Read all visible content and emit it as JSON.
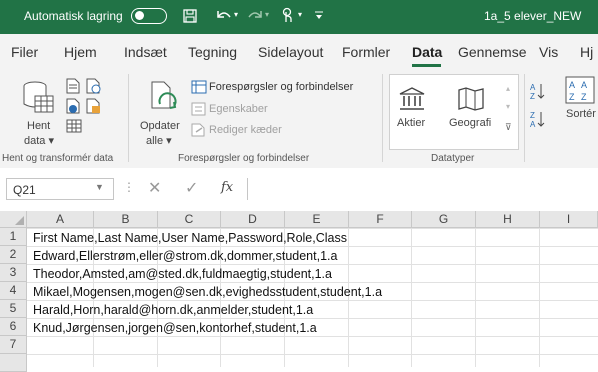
{
  "titlebar": {
    "autosave_label": "Automatisk lagring",
    "filename": "1a_5 elever_NEW",
    "icons": [
      "save-icon",
      "undo-icon",
      "redo-icon",
      "touch-mode-icon",
      "customize-qat-icon"
    ]
  },
  "menu": {
    "tabs": [
      "Filer",
      "Hjem",
      "Indsæt",
      "Tegning",
      "Sidelayout",
      "Formler",
      "Data",
      "Gennemse",
      "Vis",
      "Hj"
    ],
    "active_tab": "Data"
  },
  "ribbon": {
    "get_transform": {
      "hent_label1": "Hent",
      "hent_label2": "data ▾",
      "group_label": "Hent og transformér data"
    },
    "queries": {
      "refresh_label1": "Opdater",
      "refresh_label2": "alle ▾",
      "queries_connections": "Forespørgsler og forbindelser",
      "properties": "Egenskaber",
      "edit_links": "Rediger kæder",
      "group_label": "Forespørgsler og forbindelser"
    },
    "datatypes": {
      "stocks": "Aktier",
      "geography": "Geografi",
      "group_label": "Datatyper"
    },
    "sort": {
      "sort_label": "Sortér"
    }
  },
  "formula_bar": {
    "name_box": "Q21",
    "fx": "fx",
    "value": ""
  },
  "sheet": {
    "columns": [
      "A",
      "B",
      "C",
      "D",
      "E",
      "F",
      "G",
      "H",
      "I"
    ],
    "rows": [
      "1",
      "2",
      "3",
      "4",
      "5",
      "6",
      "7"
    ],
    "row_text": [
      "First Name,Last Name,User Name,Password,Role,Class",
      "Edward,Ellerstrøm,eller@strom.dk,dommer,student,1.a",
      "Theodor,Amsted,am@sted.dk,fuldmaegtig,student,1.a",
      "Mikael,Mogensen,mogen@sen.dk,evighedsstudent,student,1.a",
      "Harald,Horn,harald@horn.dk,anmelder,student,1.a",
      "Knud,Jørgensen,jorgen@sen,kontorhef,student,1.a",
      ""
    ]
  },
  "colors": {
    "accent": "#217346",
    "ribbon_bg": "#f3f3f3",
    "header_bg": "#e6e6e6"
  }
}
